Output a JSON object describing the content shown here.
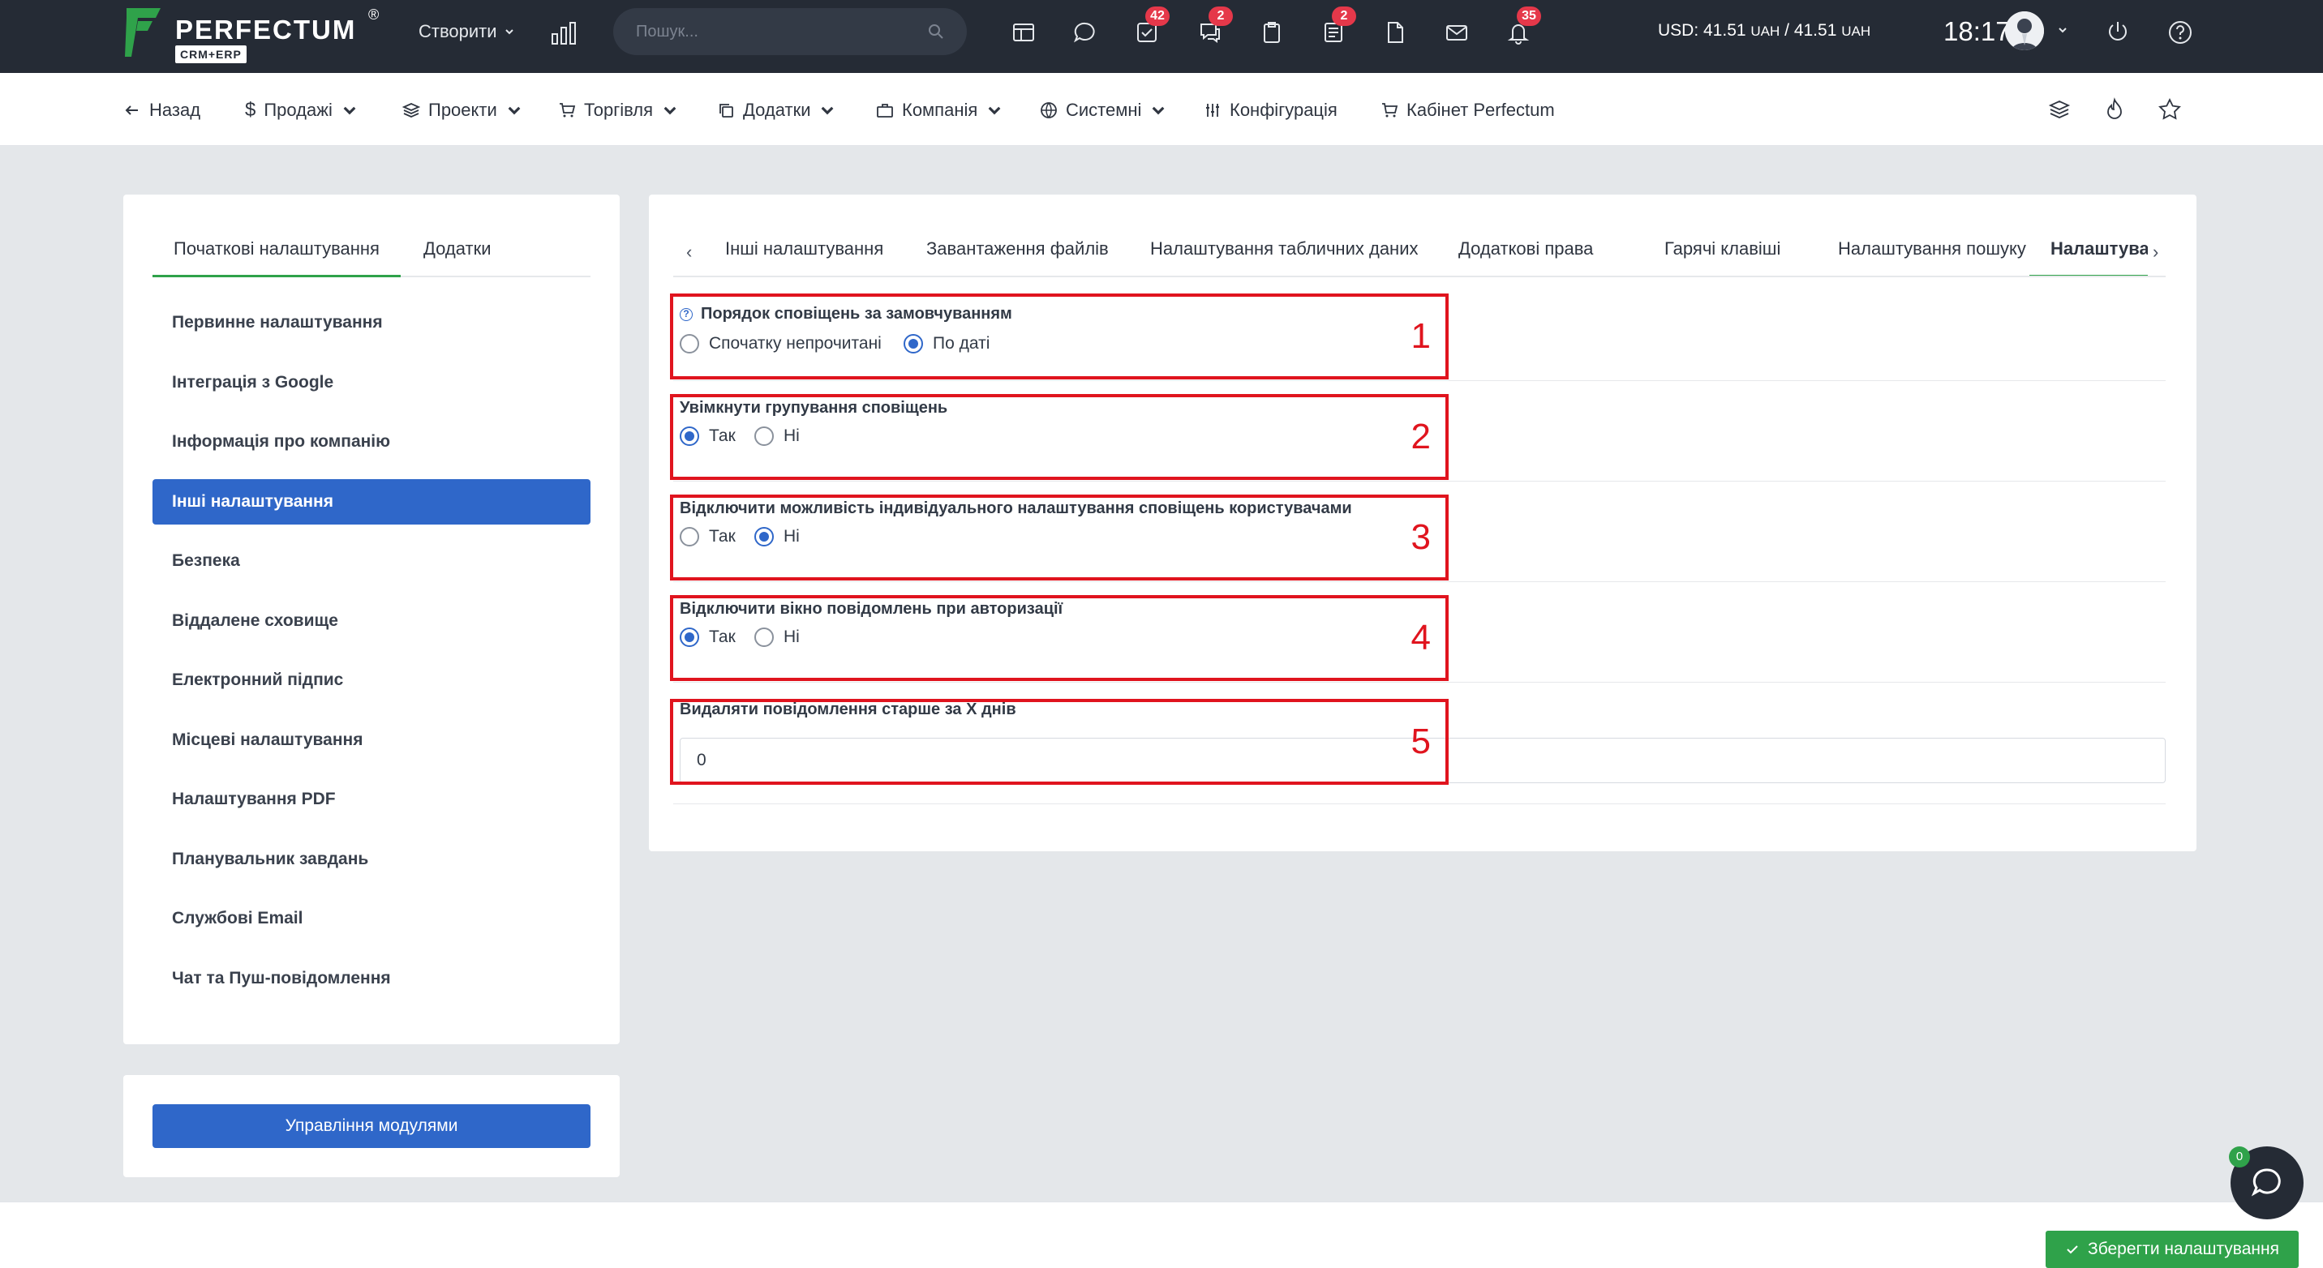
{
  "brand": {
    "name": "PERFECTUM",
    "registered": "®",
    "subtitle": "CRM+ERP",
    "green": "#2fa24a"
  },
  "topbar": {
    "create_label": "Створити",
    "search_placeholder": "Пошук...",
    "icons": [
      {
        "name": "dashboard-icon",
        "badge": ""
      },
      {
        "name": "chat-icon",
        "badge": ""
      },
      {
        "name": "tasks-icon",
        "badge": "42"
      },
      {
        "name": "discussion-icon",
        "badge": "2"
      },
      {
        "name": "clipboard-icon",
        "badge": ""
      },
      {
        "name": "notes-icon",
        "badge": "2"
      },
      {
        "name": "document-icon",
        "badge": ""
      },
      {
        "name": "mail-icon",
        "badge": ""
      },
      {
        "name": "bell-icon",
        "badge": "35"
      }
    ],
    "currency_prefix": "USD: 41.51",
    "currency_unit1": "UAH",
    "currency_mid": "/ 41.51",
    "currency_unit2": "UAH",
    "time": "18:17"
  },
  "nav": {
    "back": "Назад",
    "sales": "Продажі",
    "projects": "Проекти",
    "trade": "Торгівля",
    "addons": "Додатки",
    "company": "Компанія",
    "system": "Системні",
    "config": "Конфігурація",
    "cabinet": "Кабінет Perfectum"
  },
  "left": {
    "tabs": [
      "Початкові налаштування",
      "Додатки"
    ],
    "menu": [
      "Первинне налаштування",
      "Інтеграція з Google",
      "Інформація про компанію",
      "Інші налаштування",
      "Безпека",
      "Віддалене сховище",
      "Електронний підпис",
      "Місцеві налаштування",
      "Налаштування PDF",
      "Планувальник завдань",
      "Службові Email",
      "Чат та Пуш-повідомлення"
    ],
    "active_index": 3,
    "modules_button": "Управління модулями"
  },
  "right": {
    "tabs": [
      "Інші налаштування",
      "Завантаження файлів",
      "Налаштування табличних даних",
      "Додаткові права",
      "Гарячі клавіші",
      "Налаштування пошуку",
      "Налаштування"
    ],
    "active_tab_index": 6,
    "settings": [
      {
        "label": "Порядок сповіщень за замовчуванням",
        "options": [
          "Спочатку непрочитані",
          "По даті"
        ],
        "selected": 1,
        "annotation": "1"
      },
      {
        "label": "Увімкнути групування сповіщень",
        "options": [
          "Так",
          "Ні"
        ],
        "selected": 0,
        "annotation": "2"
      },
      {
        "label": "Відключити можливість індивідуального налаштування сповіщень користувачами",
        "options": [
          "Так",
          "Ні"
        ],
        "selected": 1,
        "annotation": "3"
      },
      {
        "label": "Відключити вікно повідомлень при авторизації",
        "options": [
          "Так",
          "Ні"
        ],
        "selected": 0,
        "annotation": "4"
      },
      {
        "label": "Видаляти повідомлення старше за X днів",
        "value": "0",
        "annotation": "5"
      }
    ],
    "annotation_color": "#e0141e",
    "accent_blue": "#2f67c9"
  },
  "footer": {
    "save_button": "Зберегти налаштування",
    "chat_count": "0"
  }
}
